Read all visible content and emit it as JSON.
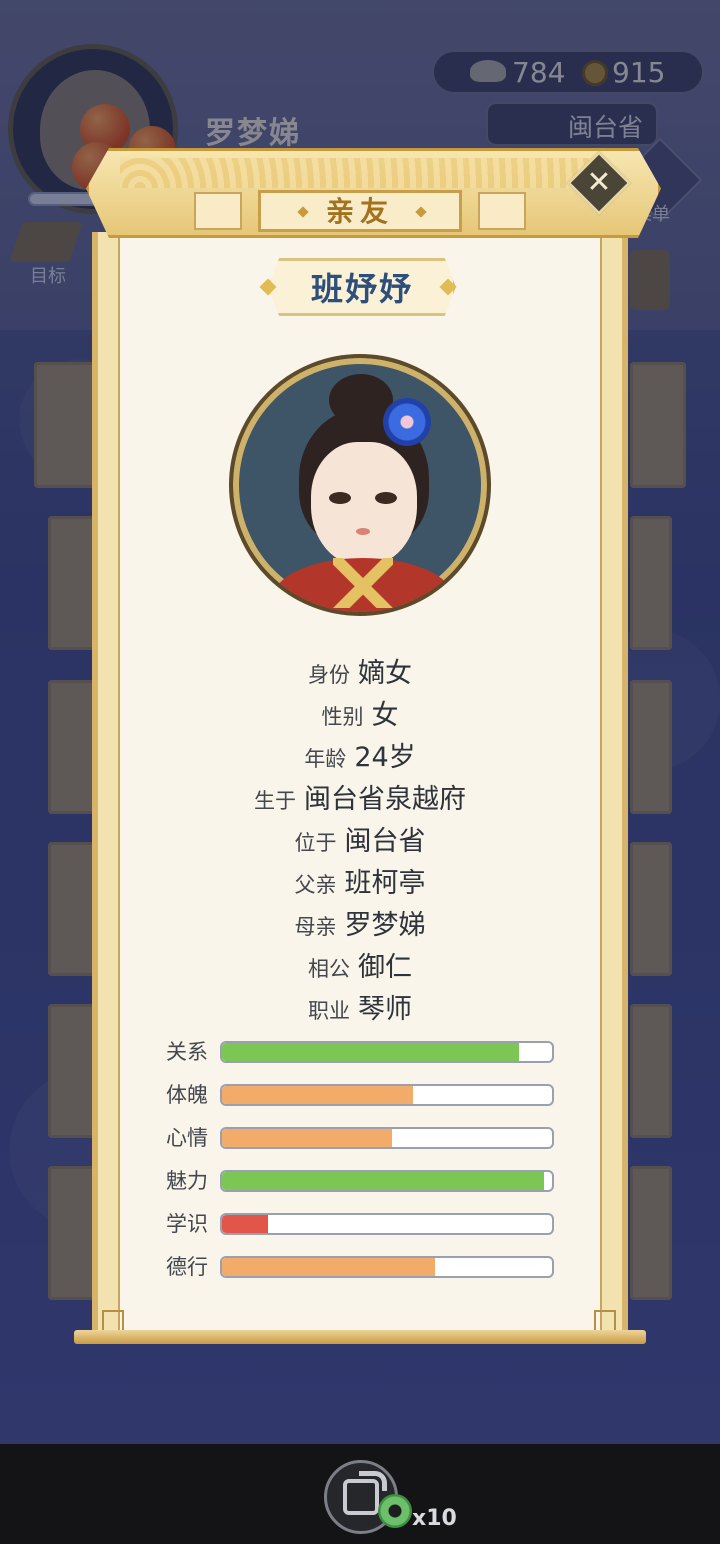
{
  "hud": {
    "player_name": "罗梦娣",
    "silver": "784",
    "coins": "915",
    "location": "闽台省",
    "goal_label": "目标",
    "menu_label": "菜单"
  },
  "dialog": {
    "title": "亲友",
    "name": "班妤妤",
    "info": [
      {
        "label": "身份",
        "value": "嫡女"
      },
      {
        "label": "性别",
        "value": "女"
      },
      {
        "label": "年龄",
        "value": "24岁"
      },
      {
        "label": "生于",
        "value": "闽台省泉越府"
      },
      {
        "label": "位于",
        "value": "闽台省"
      },
      {
        "label": "父亲",
        "value": "班柯亭"
      },
      {
        "label": "母亲",
        "value": "罗梦娣"
      },
      {
        "label": "相公",
        "value": "御仁"
      },
      {
        "label": "职业",
        "value": "琴师"
      }
    ],
    "stats": [
      {
        "label": "关系",
        "level": 0.9,
        "color": "#7cc653"
      },
      {
        "label": "体魄",
        "level": 0.58,
        "color": "#f2ab68"
      },
      {
        "label": "心情",
        "level": 0.515,
        "color": "#f2ab68"
      },
      {
        "label": "魅力",
        "level": 0.975,
        "color": "#7cc653"
      },
      {
        "label": "学识",
        "level": 0.14,
        "color": "#e2564a"
      },
      {
        "label": "德行",
        "level": 0.645,
        "color": "#f2ab68"
      }
    ]
  },
  "bottom": {
    "share_icon": "share-icon",
    "reward_count": "x10"
  }
}
